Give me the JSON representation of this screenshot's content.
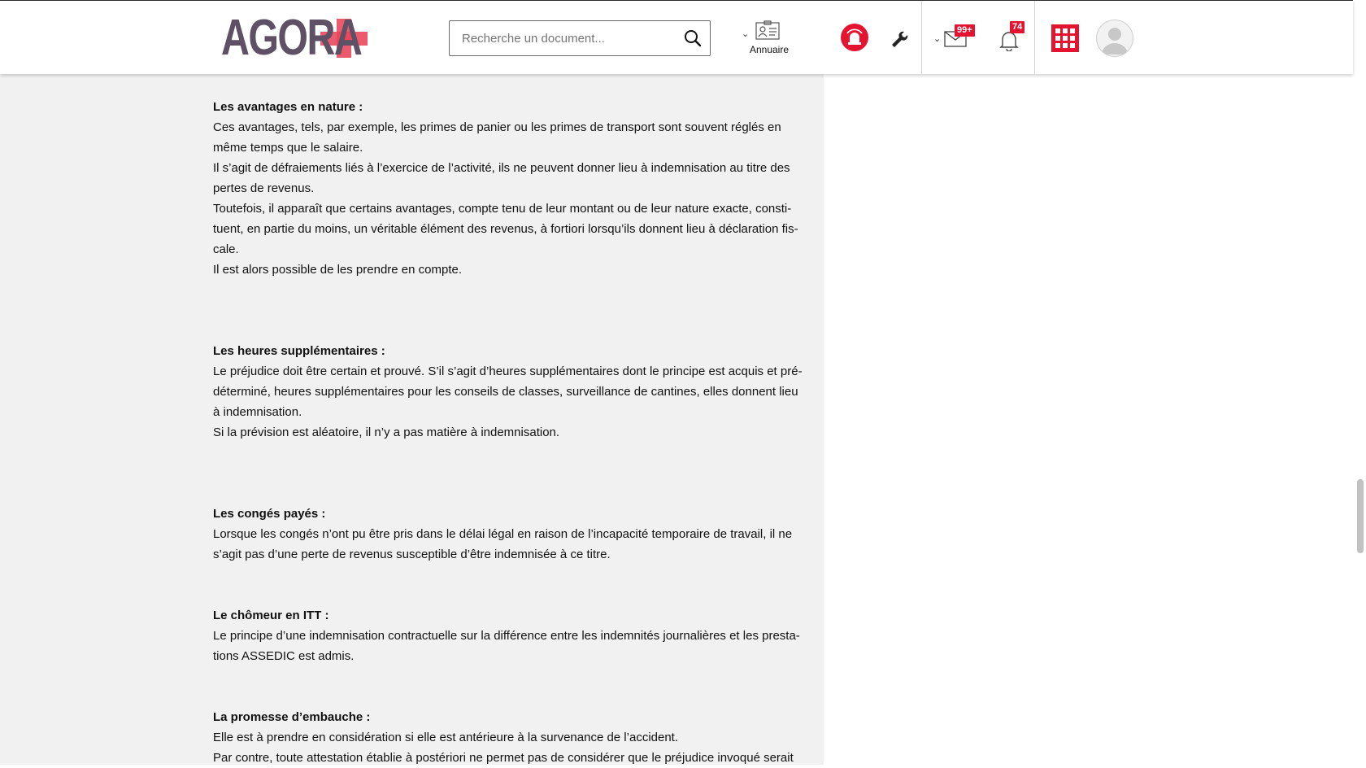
{
  "app": {
    "logo_text": "AGORA",
    "brand_color": "#e4132f",
    "logo_color": "#5e5065"
  },
  "search": {
    "placeholder": "Recherche un document...",
    "value": "",
    "icon": "search-icon"
  },
  "nav": {
    "annuaire_label": "Annuaire",
    "annuaire_icon": "contact-card-icon",
    "alert_icon": "siren-icon",
    "tools_icon": "wrench-icon",
    "mail_icon": "envelope-icon",
    "mail_badge": "99+",
    "notifications_icon": "bell-icon",
    "notifications_badge": "74",
    "apps_icon": "grid-icon",
    "profile_icon": "avatar-icon"
  },
  "document": {
    "sections": [
      {
        "title": "Les avantages en nature :",
        "lines": [
          "Ces avantages, tels, par exemple, les primes de panier ou les primes de transport sont souvent réglés en",
          "même temps que le salaire.",
          "Il s’agit de défraiements liés à l’exercice de l’activité, ils ne peuvent donner lieu à indemnisation au titre des",
          "pertes de revenus.",
          "Toutefois, il apparaît que certains avantages, compte tenu de leur montant ou de leur nature exacte, consti-",
          "tuent, en partie du moins, un véritable élément des revenus, à fortiori lorsqu’ils donnent lieu à déclaration fis-",
          "cale.",
          "Il est alors possible de les prendre en compte."
        ]
      },
      {
        "title": "Les heures supplémentaires :",
        "lines": [
          "Le préjudice doit être certain et prouvé. S’il s’agit d’heures supplémentaires dont le principe est acquis et pré-",
          "déterminé, heures supplémentaires pour les conseils de classes, surveillance de cantines, elles donnent lieu",
          "à indemnisation.",
          "Si la prévision est aléatoire, il n’y a pas matière à indemnisation."
        ]
      },
      {
        "title": "Les congés payés :",
        "lines": [
          "Lorsque les congés n’ont pu être pris dans le délai légal en raison de l’incapacité temporaire de travail, il ne",
          "s’agit pas d’une perte de revenus susceptible d’être indemnisée à ce titre."
        ]
      },
      {
        "title": "Le chômeur en ITT :",
        "lines": [
          "Le principe d’une indemnisation contractuelle sur la différence entre les indemnités journalières et les presta-",
          "tions ASSEDIC est admis."
        ]
      },
      {
        "title": "La promesse d’embauche :",
        "lines": [
          "Elle est à prendre en considération si elle est antérieure à la survenance de l’accident.",
          "Par contre, toute attestation établie à postériori ne permet pas de considérer que le préjudice invoqué serait"
        ]
      }
    ]
  }
}
